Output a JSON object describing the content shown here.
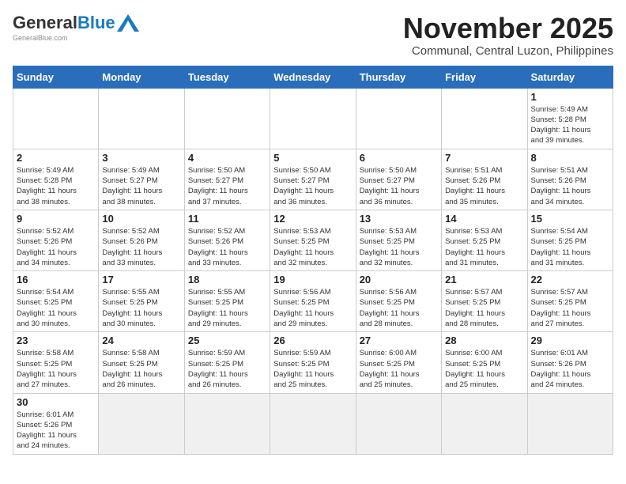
{
  "logo": {
    "general": "General",
    "blue": "Blue",
    "url": "GeneralBlue.com"
  },
  "title": {
    "month": "November 2025",
    "location": "Communal, Central Luzon, Philippines"
  },
  "weekdays": [
    "Sunday",
    "Monday",
    "Tuesday",
    "Wednesday",
    "Thursday",
    "Friday",
    "Saturday"
  ],
  "weeks": [
    [
      {
        "day": "",
        "info": ""
      },
      {
        "day": "",
        "info": ""
      },
      {
        "day": "",
        "info": ""
      },
      {
        "day": "",
        "info": ""
      },
      {
        "day": "",
        "info": ""
      },
      {
        "day": "",
        "info": ""
      },
      {
        "day": "1",
        "info": "Sunrise: 5:49 AM\nSunset: 5:28 PM\nDaylight: 11 hours\nand 39 minutes."
      }
    ],
    [
      {
        "day": "2",
        "info": "Sunrise: 5:49 AM\nSunset: 5:28 PM\nDaylight: 11 hours\nand 38 minutes."
      },
      {
        "day": "3",
        "info": "Sunrise: 5:49 AM\nSunset: 5:27 PM\nDaylight: 11 hours\nand 38 minutes."
      },
      {
        "day": "4",
        "info": "Sunrise: 5:50 AM\nSunset: 5:27 PM\nDaylight: 11 hours\nand 37 minutes."
      },
      {
        "day": "5",
        "info": "Sunrise: 5:50 AM\nSunset: 5:27 PM\nDaylight: 11 hours\nand 36 minutes."
      },
      {
        "day": "6",
        "info": "Sunrise: 5:50 AM\nSunset: 5:27 PM\nDaylight: 11 hours\nand 36 minutes."
      },
      {
        "day": "7",
        "info": "Sunrise: 5:51 AM\nSunset: 5:26 PM\nDaylight: 11 hours\nand 35 minutes."
      },
      {
        "day": "8",
        "info": "Sunrise: 5:51 AM\nSunset: 5:26 PM\nDaylight: 11 hours\nand 34 minutes."
      }
    ],
    [
      {
        "day": "9",
        "info": "Sunrise: 5:52 AM\nSunset: 5:26 PM\nDaylight: 11 hours\nand 34 minutes."
      },
      {
        "day": "10",
        "info": "Sunrise: 5:52 AM\nSunset: 5:26 PM\nDaylight: 11 hours\nand 33 minutes."
      },
      {
        "day": "11",
        "info": "Sunrise: 5:52 AM\nSunset: 5:26 PM\nDaylight: 11 hours\nand 33 minutes."
      },
      {
        "day": "12",
        "info": "Sunrise: 5:53 AM\nSunset: 5:25 PM\nDaylight: 11 hours\nand 32 minutes."
      },
      {
        "day": "13",
        "info": "Sunrise: 5:53 AM\nSunset: 5:25 PM\nDaylight: 11 hours\nand 32 minutes."
      },
      {
        "day": "14",
        "info": "Sunrise: 5:53 AM\nSunset: 5:25 PM\nDaylight: 11 hours\nand 31 minutes."
      },
      {
        "day": "15",
        "info": "Sunrise: 5:54 AM\nSunset: 5:25 PM\nDaylight: 11 hours\nand 31 minutes."
      }
    ],
    [
      {
        "day": "16",
        "info": "Sunrise: 5:54 AM\nSunset: 5:25 PM\nDaylight: 11 hours\nand 30 minutes."
      },
      {
        "day": "17",
        "info": "Sunrise: 5:55 AM\nSunset: 5:25 PM\nDaylight: 11 hours\nand 30 minutes."
      },
      {
        "day": "18",
        "info": "Sunrise: 5:55 AM\nSunset: 5:25 PM\nDaylight: 11 hours\nand 29 minutes."
      },
      {
        "day": "19",
        "info": "Sunrise: 5:56 AM\nSunset: 5:25 PM\nDaylight: 11 hours\nand 29 minutes."
      },
      {
        "day": "20",
        "info": "Sunrise: 5:56 AM\nSunset: 5:25 PM\nDaylight: 11 hours\nand 28 minutes."
      },
      {
        "day": "21",
        "info": "Sunrise: 5:57 AM\nSunset: 5:25 PM\nDaylight: 11 hours\nand 28 minutes."
      },
      {
        "day": "22",
        "info": "Sunrise: 5:57 AM\nSunset: 5:25 PM\nDaylight: 11 hours\nand 27 minutes."
      }
    ],
    [
      {
        "day": "23",
        "info": "Sunrise: 5:58 AM\nSunset: 5:25 PM\nDaylight: 11 hours\nand 27 minutes."
      },
      {
        "day": "24",
        "info": "Sunrise: 5:58 AM\nSunset: 5:25 PM\nDaylight: 11 hours\nand 26 minutes."
      },
      {
        "day": "25",
        "info": "Sunrise: 5:59 AM\nSunset: 5:25 PM\nDaylight: 11 hours\nand 26 minutes."
      },
      {
        "day": "26",
        "info": "Sunrise: 5:59 AM\nSunset: 5:25 PM\nDaylight: 11 hours\nand 25 minutes."
      },
      {
        "day": "27",
        "info": "Sunrise: 6:00 AM\nSunset: 5:25 PM\nDaylight: 11 hours\nand 25 minutes."
      },
      {
        "day": "28",
        "info": "Sunrise: 6:00 AM\nSunset: 5:25 PM\nDaylight: 11 hours\nand 25 minutes."
      },
      {
        "day": "29",
        "info": "Sunrise: 6:01 AM\nSunset: 5:26 PM\nDaylight: 11 hours\nand 24 minutes."
      }
    ],
    [
      {
        "day": "30",
        "info": "Sunrise: 6:01 AM\nSunset: 5:26 PM\nDaylight: 11 hours\nand 24 minutes."
      },
      {
        "day": "",
        "info": ""
      },
      {
        "day": "",
        "info": ""
      },
      {
        "day": "",
        "info": ""
      },
      {
        "day": "",
        "info": ""
      },
      {
        "day": "",
        "info": ""
      },
      {
        "day": "",
        "info": ""
      }
    ]
  ]
}
